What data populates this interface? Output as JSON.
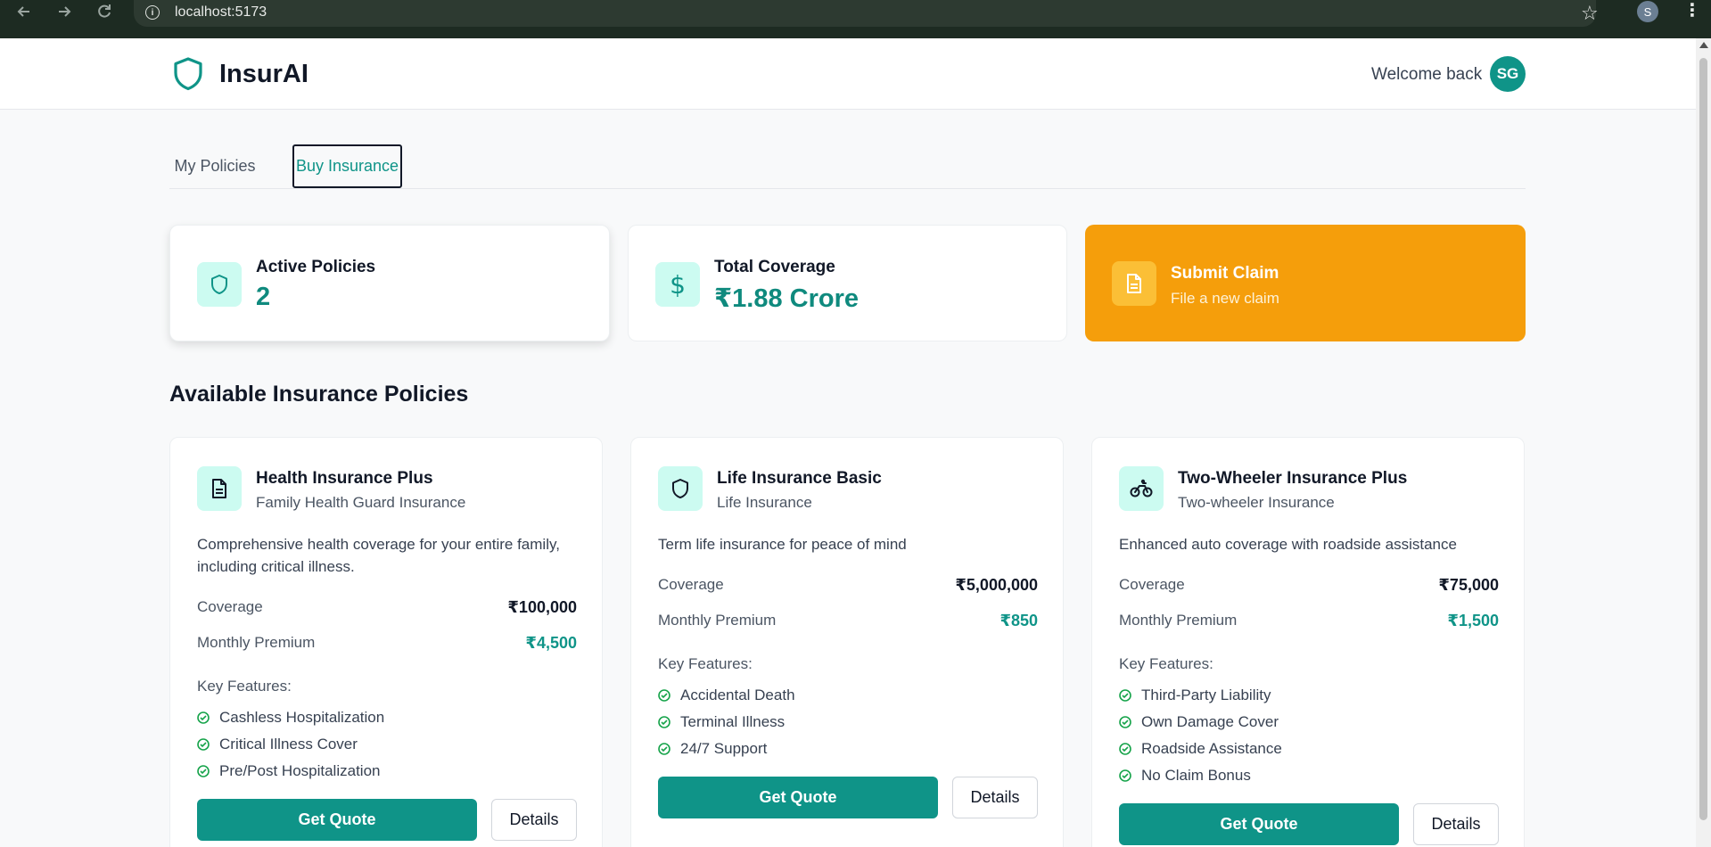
{
  "browser": {
    "url": "localhost:5173",
    "profile_initial": "S"
  },
  "header": {
    "brand": "InsurAI",
    "welcome": "Welcome back",
    "avatar_initials": "SG"
  },
  "tabs": [
    {
      "label": "My Policies",
      "active": false
    },
    {
      "label": "Buy Insurance",
      "active": true
    }
  ],
  "stats": {
    "active_policies": {
      "label": "Active Policies",
      "value": "2"
    },
    "total_coverage": {
      "label": "Total Coverage",
      "value": "₹1.88 Crore"
    },
    "claim": {
      "title": "Submit Claim",
      "subtitle": "File a new claim"
    }
  },
  "section_title": "Available Insurance Policies",
  "policies": [
    {
      "name": "Health Insurance Plus",
      "type": "Family Health Guard Insurance",
      "description": "Comprehensive health coverage for your entire family, including critical illness.",
      "coverage_label": "Coverage",
      "coverage": "₹100,000",
      "premium_label": "Monthly Premium",
      "premium": "₹4,500",
      "features_label": "Key Features:",
      "features": [
        "Cashless Hospitalization",
        "Critical Illness Cover",
        "Pre/Post Hospitalization"
      ],
      "quote_label": "Get Quote",
      "details_label": "Details",
      "icon": "document-icon"
    },
    {
      "name": "Life Insurance Basic",
      "type": "Life Insurance",
      "description": "Term life insurance for peace of mind",
      "coverage_label": "Coverage",
      "coverage": "₹5,000,000",
      "premium_label": "Monthly Premium",
      "premium": "₹850",
      "features_label": "Key Features:",
      "features": [
        "Accidental Death",
        "Terminal Illness",
        "24/7 Support"
      ],
      "quote_label": "Get Quote",
      "details_label": "Details",
      "icon": "shield-icon"
    },
    {
      "name": "Two-Wheeler Insurance Plus",
      "type": "Two-wheeler Insurance",
      "description": "Enhanced auto coverage with roadside assistance",
      "coverage_label": "Coverage",
      "coverage": "₹75,000",
      "premium_label": "Monthly Premium",
      "premium": "₹1,500",
      "features_label": "Key Features:",
      "features": [
        "Third-Party Liability",
        "Own Damage Cover",
        "Roadside Assistance",
        "No Claim Bonus"
      ],
      "quote_label": "Get Quote",
      "details_label": "Details",
      "icon": "bike-icon"
    }
  ],
  "colors": {
    "primary": "#0f9488",
    "accent": "#f59e0b",
    "icon_bg": "#ccfbf1"
  }
}
